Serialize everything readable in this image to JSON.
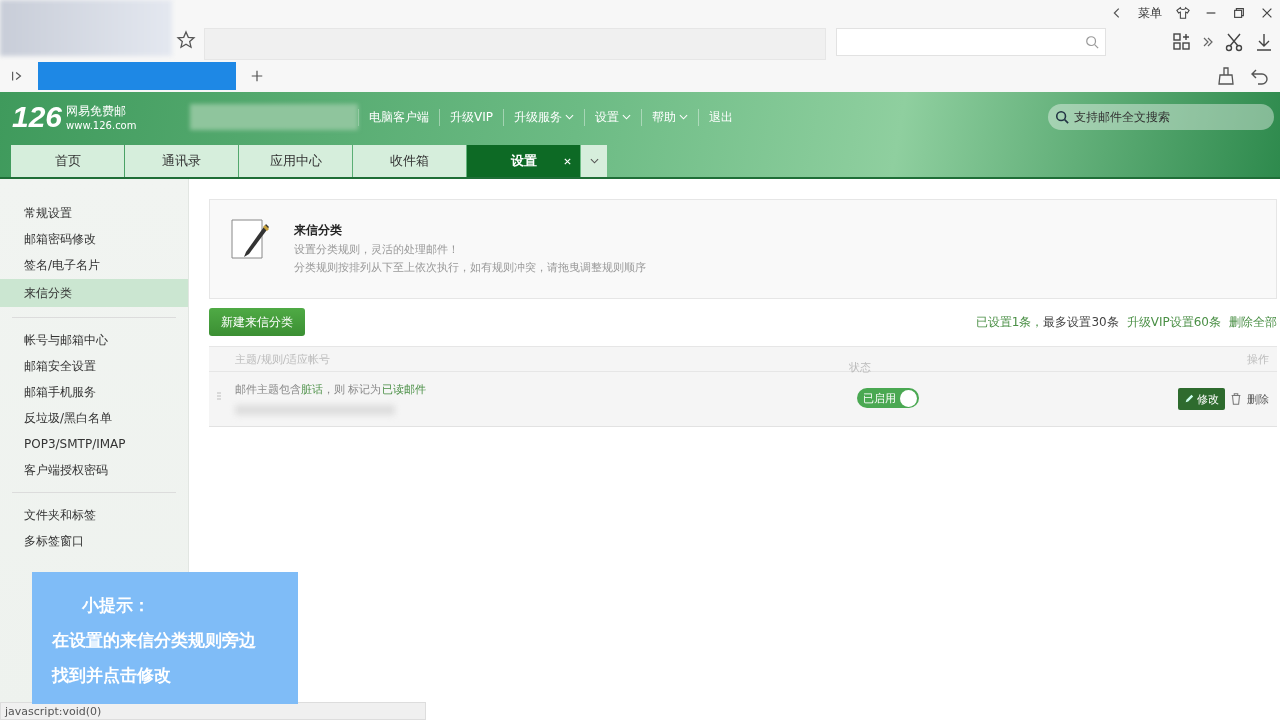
{
  "browser": {
    "menu_label": "菜单",
    "status_url": "javascript:void(0)"
  },
  "header": {
    "logo_number": "126",
    "logo_name": "网易免费邮",
    "logo_domain": "www.126.com",
    "links": [
      {
        "label": "电脑客户端",
        "dropdown": false
      },
      {
        "label": "升级VIP",
        "dropdown": false
      },
      {
        "label": "升级服务",
        "dropdown": true
      },
      {
        "label": "设置",
        "dropdown": true
      },
      {
        "label": "帮助",
        "dropdown": true
      },
      {
        "label": "退出",
        "dropdown": false
      }
    ],
    "search": {
      "placeholder": "支持邮件全文搜索"
    }
  },
  "tabs": [
    {
      "label": "首页",
      "selected": false
    },
    {
      "label": "通讯录",
      "selected": false
    },
    {
      "label": "应用中心",
      "selected": false
    },
    {
      "label": "收件箱",
      "selected": false
    },
    {
      "label": "设置",
      "selected": true,
      "closable": true
    }
  ],
  "sidebar": {
    "groups": [
      [
        {
          "label": "常规设置",
          "selected": false
        },
        {
          "label": "邮箱密码修改",
          "selected": false
        },
        {
          "label": "签名/电子名片",
          "selected": false
        },
        {
          "label": "来信分类",
          "selected": true
        }
      ],
      [
        {
          "label": "帐号与邮箱中心",
          "selected": false
        },
        {
          "label": "邮箱安全设置",
          "selected": false
        },
        {
          "label": "邮箱手机服务",
          "selected": false
        },
        {
          "label": "反垃圾/黑白名单",
          "selected": false
        },
        {
          "label": "POP3/SMTP/IMAP",
          "selected": false
        },
        {
          "label": "客户端授权密码",
          "selected": false
        }
      ],
      [
        {
          "label": "文件夹和标签",
          "selected": false
        },
        {
          "label": "多标签窗口",
          "selected": false
        }
      ]
    ]
  },
  "intro": {
    "title": "来信分类",
    "lines": [
      "设置分类规则，灵活的处理邮件！",
      "分类规则按排列从下至上依次执行，如有规则冲突，请拖曳调整规则顺序"
    ]
  },
  "new_button": "新建来信分类",
  "summary": {
    "count_text": "已设置1条，",
    "limit_text": "最多设置30条",
    "upgrade_link": "升级VIP设置60条",
    "delete_all": "删除全部"
  },
  "table": {
    "columns": [
      "主题/规则/适应帐号",
      "状态",
      "操作"
    ],
    "rows": [
      {
        "rule": "邮件主题包含**脏话**，则 标记为**已读邮件**",
        "status": "已启用",
        "enabled": true,
        "edit": "修改",
        "delete": "删除"
      }
    ]
  },
  "tip": {
    "title": "小提示：",
    "lines": [
      "在设置的来信分类规则旁边",
      "找到并点击修改"
    ]
  }
}
